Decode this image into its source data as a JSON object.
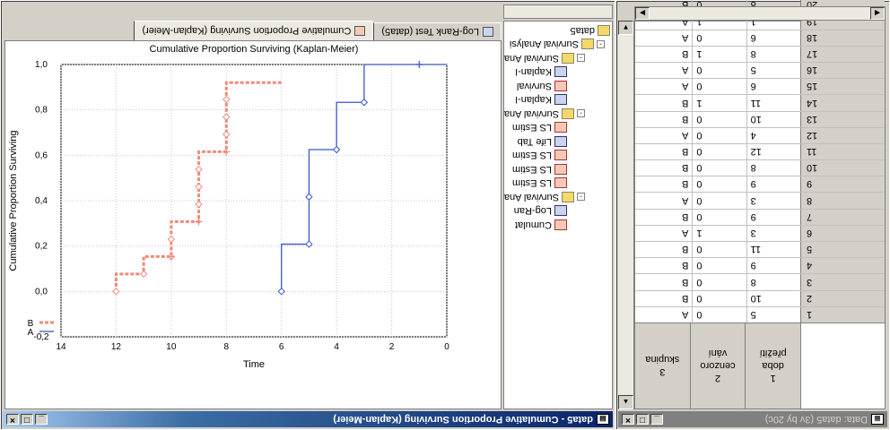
{
  "data_window": {
    "title": "Data: data5 (3v by 20c)",
    "columns": [
      {
        "num": "1",
        "lines": [
          "doba",
          "přežití"
        ]
      },
      {
        "num": "2",
        "lines": [
          "cenzoro",
          "vání"
        ]
      },
      {
        "num": "3",
        "lines": [
          "skupina",
          ""
        ]
      }
    ],
    "rows": [
      {
        "id": "1",
        "c1": "5",
        "c2": "0",
        "c3": "A"
      },
      {
        "id": "2",
        "c1": "10",
        "c2": "0",
        "c3": "B"
      },
      {
        "id": "3",
        "c1": "8",
        "c2": "0",
        "c3": "B"
      },
      {
        "id": "4",
        "c1": "9",
        "c2": "0",
        "c3": "B"
      },
      {
        "id": "5",
        "c1": "11",
        "c2": "0",
        "c3": "B"
      },
      {
        "id": "6",
        "c1": "3",
        "c2": "1",
        "c3": "A"
      },
      {
        "id": "7",
        "c1": "9",
        "c2": "0",
        "c3": "B"
      },
      {
        "id": "8",
        "c1": "3",
        "c2": "0",
        "c3": "A"
      },
      {
        "id": "9",
        "c1": "9",
        "c2": "0",
        "c3": "B"
      },
      {
        "id": "10",
        "c1": "8",
        "c2": "0",
        "c3": "B"
      },
      {
        "id": "11",
        "c1": "12",
        "c2": "0",
        "c3": "B"
      },
      {
        "id": "12",
        "c1": "4",
        "c2": "0",
        "c3": "A"
      },
      {
        "id": "13",
        "c1": "10",
        "c2": "0",
        "c3": "B"
      },
      {
        "id": "14",
        "c1": "11",
        "c2": "1",
        "c3": "B"
      },
      {
        "id": "15",
        "c1": "6",
        "c2": "0",
        "c3": "A"
      },
      {
        "id": "16",
        "c1": "5",
        "c2": "0",
        "c3": "A"
      },
      {
        "id": "17",
        "c1": "8",
        "c2": "1",
        "c3": "B"
      },
      {
        "id": "18",
        "c1": "6",
        "c2": "0",
        "c3": "A"
      },
      {
        "id": "19",
        "c1": "1",
        "c2": "1",
        "c3": "A"
      },
      {
        "id": "20",
        "c1": "8",
        "c2": "0",
        "c3": "B"
      }
    ]
  },
  "graph_window": {
    "title": "data5 - Cumulative Proportion Surviving (Kaplan-Meier)",
    "tabs": [
      {
        "label": "Log-Rank Test (data5)"
      },
      {
        "label": "Cumulative Proportion Surviving (Kaplan-Meier)"
      }
    ],
    "tree": [
      {
        "label": "data5",
        "icon": "folder",
        "pm": ""
      },
      {
        "label": "Survival Analysi",
        "icon": "folder",
        "pm": "-"
      },
      {
        "label": "Survival Ana",
        "icon": "folder",
        "pm": "-"
      },
      {
        "label": "Kaplan-I",
        "icon": "table",
        "pm": ""
      },
      {
        "label": "Survival",
        "icon": "chart",
        "pm": ""
      },
      {
        "label": "Kaplan-I",
        "icon": "table",
        "pm": ""
      },
      {
        "label": "Survival Ana",
        "icon": "folder",
        "pm": "-"
      },
      {
        "label": "LS Estim",
        "icon": "chart",
        "pm": ""
      },
      {
        "label": "Life Tab",
        "icon": "table",
        "pm": ""
      },
      {
        "label": "LS Estim",
        "icon": "chart",
        "pm": ""
      },
      {
        "label": "LS Estim",
        "icon": "chart",
        "pm": ""
      },
      {
        "label": "LS Estim",
        "icon": "chart",
        "pm": ""
      },
      {
        "label": "Survival Ana",
        "icon": "folder",
        "pm": "-"
      },
      {
        "label": "Log-Ran",
        "icon": "table",
        "pm": ""
      },
      {
        "label": "Cumulat",
        "icon": "chart",
        "pm": ""
      }
    ]
  },
  "chart_data": {
    "type": "line",
    "title": "Cumulative Proportion Surviving (Kaplan-Meier)",
    "xlabel": "Time",
    "ylabel": "Cumulative Proportion Surviving",
    "xlim": [
      0,
      14
    ],
    "ylim": [
      -0.2,
      1.0
    ],
    "xticks": [
      "0",
      "2",
      "4",
      "6",
      "8",
      "10",
      "12",
      "14"
    ],
    "yticks": [
      "1,0",
      "0,8",
      "0,6",
      "0,4",
      "0,2",
      "0,0",
      "-0,2"
    ],
    "legend": [
      "A",
      "B"
    ],
    "legend_markers": [
      {
        "label": "Complete",
        "color": "#3b55c8"
      },
      {
        "label": "Censored",
        "color": "#3b55c8"
      }
    ],
    "series": [
      {
        "name": "A",
        "color": "#3b55c8",
        "steps": [
          [
            0,
            1.0
          ],
          [
            3,
            1.0
          ],
          [
            3,
            0.8333
          ],
          [
            4,
            0.8333
          ],
          [
            4,
            0.625
          ],
          [
            5,
            0.625
          ],
          [
            5,
            0.2083
          ],
          [
            6,
            0.2083
          ],
          [
            6,
            0.0
          ]
        ],
        "complete": [
          [
            3,
            0.8333
          ],
          [
            4,
            0.625
          ],
          [
            5,
            0.4167
          ],
          [
            5,
            0.2083
          ],
          [
            6,
            0.0
          ]
        ],
        "censored": [
          [
            1,
            1.0
          ]
        ]
      },
      {
        "name": "B",
        "color": "#f08a7a",
        "steps": [
          [
            6,
            0.92
          ],
          [
            8,
            0.92
          ],
          [
            8,
            0.6154
          ],
          [
            9,
            0.6154
          ],
          [
            9,
            0.3077
          ],
          [
            10,
            0.3077
          ],
          [
            10,
            0.1538
          ],
          [
            11,
            0.1538
          ],
          [
            11,
            0.0769
          ],
          [
            12,
            0.0769
          ],
          [
            12,
            0.0
          ]
        ],
        "complete": [
          [
            8,
            0.846
          ],
          [
            8,
            0.769
          ],
          [
            8,
            0.692
          ],
          [
            9,
            0.538
          ],
          [
            9,
            0.461
          ],
          [
            9,
            0.384
          ],
          [
            10,
            0.23
          ],
          [
            10,
            0.153
          ],
          [
            11,
            0.0769
          ],
          [
            12,
            0.0
          ]
        ],
        "censored": [
          [
            8,
            0.6154
          ],
          [
            9,
            0.3077
          ],
          [
            10,
            0.1538
          ]
        ]
      }
    ]
  }
}
